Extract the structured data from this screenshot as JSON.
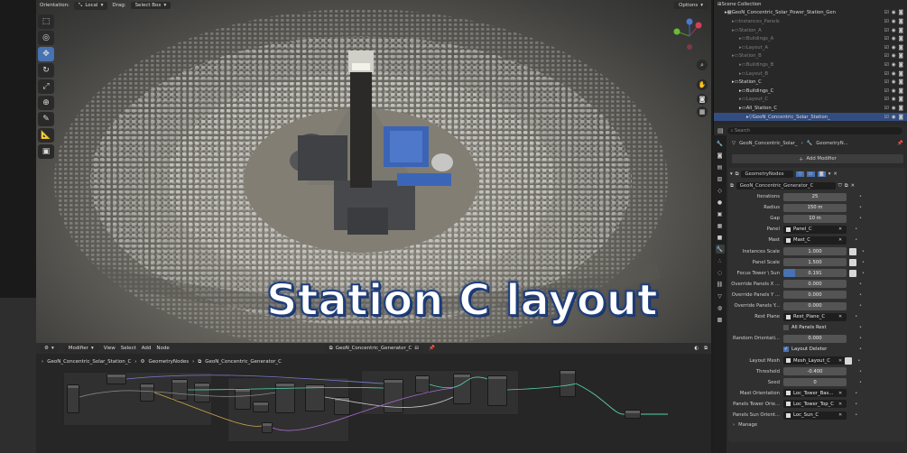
{
  "viewport": {
    "orientation_label": "Orientation:",
    "orientation_value": "Local",
    "drag_label": "Drag:",
    "drag_value": "Select Box",
    "options_label": "Options",
    "overlay_title": "Station C layout"
  },
  "tools": [
    "select-icon",
    "cursor-icon",
    "move-icon",
    "rotate-icon",
    "scale-icon",
    "transform-icon",
    "annotate-icon",
    "measure-icon",
    "add-cube-icon"
  ],
  "node_editor": {
    "editor_type": "Modifier",
    "menus": [
      "View",
      "Select",
      "Add",
      "Node"
    ],
    "node_group": "GeoN_Concentric_Generator_C",
    "breadcrumb": [
      "GeoN_Concentric_Solar_Station_C",
      "GeometryNodes",
      "GeoN_Concentric_Generator_C"
    ]
  },
  "outliner": {
    "rows": [
      {
        "label": "Scene Collection",
        "indent": 0,
        "dim": false,
        "sel": false
      },
      {
        "label": "GeoN_Concentric_Solar_Power_Station_Gen",
        "indent": 1,
        "dim": false,
        "sel": false
      },
      {
        "label": "Instances_Panels",
        "indent": 2,
        "dim": true,
        "sel": false
      },
      {
        "label": "Station_A",
        "indent": 2,
        "dim": true,
        "sel": false
      },
      {
        "label": "Buildings_A",
        "indent": 3,
        "dim": true,
        "sel": false
      },
      {
        "label": "Layout_A",
        "indent": 3,
        "dim": true,
        "sel": false
      },
      {
        "label": "Station_B",
        "indent": 2,
        "dim": true,
        "sel": false
      },
      {
        "label": "Buildings_B",
        "indent": 3,
        "dim": true,
        "sel": false
      },
      {
        "label": "Layout_B",
        "indent": 3,
        "dim": true,
        "sel": false
      },
      {
        "label": "Station_C",
        "indent": 2,
        "dim": false,
        "sel": false
      },
      {
        "label": "Buildings_C",
        "indent": 3,
        "dim": false,
        "sel": false
      },
      {
        "label": "Layout_C",
        "indent": 3,
        "dim": true,
        "sel": false
      },
      {
        "label": "All_Station_C",
        "indent": 3,
        "dim": false,
        "sel": false
      },
      {
        "label": "GeoN_Concentric_Solar_Station_",
        "indent": 4,
        "dim": false,
        "sel": true
      }
    ]
  },
  "properties": {
    "search_placeholder": "Search",
    "object_name": "GeoN_Concentric_Solar_",
    "modifier_crumb": "GeometryN...",
    "add_modifier": "Add Modifier",
    "modifier_name": "GeometryNodes",
    "node_group": "GeoN_Concentric_Generator_C",
    "fields": [
      {
        "label": "Iterations",
        "value": "25",
        "kind": "num"
      },
      {
        "label": "Radius",
        "value": "150 m",
        "kind": "num"
      },
      {
        "label": "Gap",
        "value": "10 m",
        "kind": "num"
      },
      {
        "label": "Panel",
        "value": "Panel_C",
        "kind": "obj"
      },
      {
        "label": "Mast",
        "value": "Mast_C",
        "kind": "obj"
      },
      {
        "label": "Instances Scale",
        "value": "1.000",
        "kind": "num"
      },
      {
        "label": "Panel Scale",
        "value": "1.500",
        "kind": "num"
      },
      {
        "label": "Focus Tower \\ Sun",
        "value": "0.191",
        "kind": "slider"
      },
      {
        "label": "Override Panels X ...",
        "value": "0.000",
        "kind": "num"
      },
      {
        "label": "Override Panels Y ...",
        "value": "0.000",
        "kind": "num"
      },
      {
        "label": "Override Panels Y...",
        "value": "0.000",
        "kind": "num"
      },
      {
        "label": "Rest Plane",
        "value": "Rest_Plane_C",
        "kind": "obj"
      },
      {
        "label": "",
        "value": "All Panels Rest",
        "kind": "check"
      },
      {
        "label": "Random Orientati...",
        "value": "0.000",
        "kind": "num"
      },
      {
        "label": "",
        "value": "Layout Deleter",
        "kind": "checkon"
      },
      {
        "label": "Layout Mesh",
        "value": "Mesh_Layout_C",
        "kind": "obj"
      },
      {
        "label": "Threshold",
        "value": "-0.400",
        "kind": "num"
      },
      {
        "label": "Seed",
        "value": "0",
        "kind": "num"
      },
      {
        "label": "Mast Orientation",
        "value": "Loc_Tower_Bas...",
        "kind": "obj"
      },
      {
        "label": "Panels Tower Orie...",
        "value": "Loc_Tower_Top_C",
        "kind": "obj"
      },
      {
        "label": "Panels Sun Orient...",
        "value": "Loc_Sun_C",
        "kind": "obj"
      }
    ],
    "focus_fraction": 0.191,
    "manage": "Manage"
  },
  "colors": {
    "accent": "#4772b3",
    "title_outline": "#1f3e7a",
    "selected_row": "#334d80"
  }
}
